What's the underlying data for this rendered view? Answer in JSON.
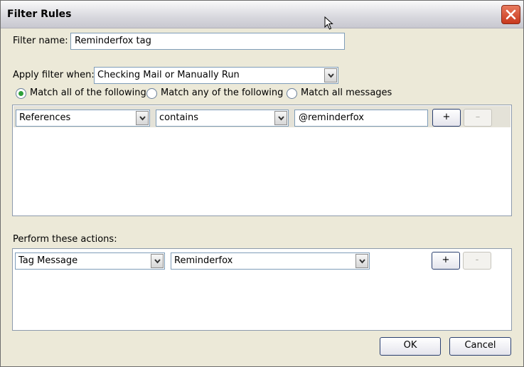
{
  "window": {
    "title": "Filter Rules"
  },
  "filter_name": {
    "label": "Filter name:",
    "value": "Reminderfox tag"
  },
  "apply_when": {
    "label": "Apply filter when:",
    "value": "Checking Mail or Manually Run"
  },
  "match": {
    "options": [
      {
        "label": "Match all of the following",
        "selected": true
      },
      {
        "label": "Match any of the following",
        "selected": false
      },
      {
        "label": "Match all messages",
        "selected": false
      }
    ]
  },
  "rule": {
    "field": "References",
    "operator": "contains",
    "value": "@reminderfox",
    "add": "+",
    "remove": "–"
  },
  "actions": {
    "label": "Perform these actions:",
    "action": "Tag Message",
    "target": "Reminderfox",
    "add": "+",
    "remove": "-"
  },
  "buttons": {
    "ok": "OK",
    "cancel": "Cancel"
  },
  "icons": {
    "close": "close-icon",
    "cursor": "mouse-cursor-icon",
    "dropdown": "chevron-down-icon"
  },
  "colors": {
    "radio_selected": "#2ea03a",
    "close": "#c8381c"
  }
}
